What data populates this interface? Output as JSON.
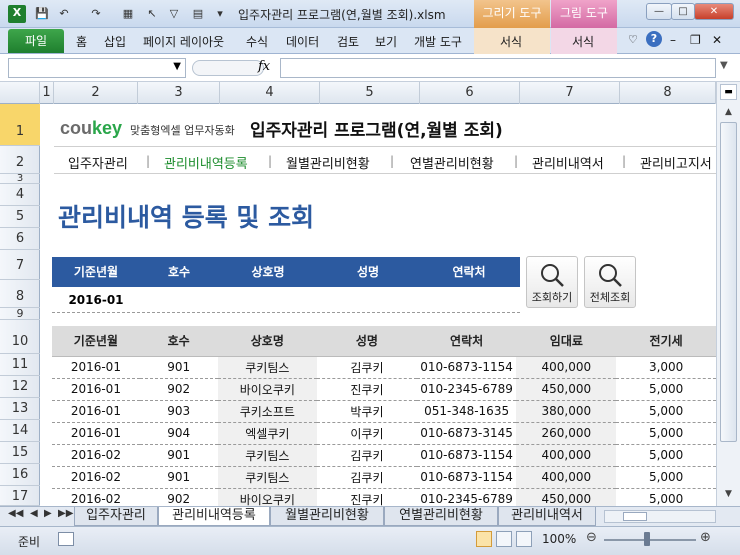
{
  "window": {
    "title": "입주자관리 프로그램(연,월별 조회).xlsm",
    "context_tabs": [
      "그리기 도구",
      "그림 도구"
    ]
  },
  "ribbon": {
    "file": "파일",
    "tabs": [
      "홈",
      "삽입",
      "페이지 레이아웃",
      "수식",
      "데이터",
      "검토",
      "보기",
      "개발 도구"
    ],
    "context_sub": [
      "서식",
      "서식"
    ]
  },
  "formula_bar": {
    "fx": "fx"
  },
  "columns": [
    "1",
    "2",
    "3",
    "4",
    "5",
    "6",
    "7",
    "8"
  ],
  "rows": [
    "1",
    "2",
    "3",
    "4",
    "5",
    "6",
    "7",
    "8",
    "9",
    "10",
    "11",
    "12",
    "13",
    "14",
    "15",
    "16",
    "17"
  ],
  "brand": {
    "logo_cou": "cou",
    "logo_key": "key",
    "tagline": "맞춤형엑셀 업무자동화",
    "title": "입주자관리 프로그램(연,월별 조회)"
  },
  "menu": [
    "입주자관리",
    "관리비내역등록",
    "월별관리비현황",
    "연별관리비현황",
    "관리비내역서",
    "관리비고지서"
  ],
  "page_heading": "관리비내역 등록 및 조회",
  "search_panel": {
    "headers": [
      "기준년월",
      "호수",
      "상호명",
      "성명",
      "연락처"
    ],
    "values": [
      "2016-01",
      "",
      "",
      "",
      ""
    ]
  },
  "buttons": {
    "search": "조회하기",
    "search_all": "전체조회"
  },
  "table": {
    "headers": [
      "기준년월",
      "호수",
      "상호명",
      "성명",
      "연락처",
      "임대료",
      "전기세"
    ],
    "rows": [
      [
        "2016-01",
        "901",
        "쿠키팀스",
        "김쿠키",
        "010-6873-1154",
        "400,000",
        "3,000"
      ],
      [
        "2016-01",
        "902",
        "바이오쿠키",
        "진쿠키",
        "010-2345-6789",
        "450,000",
        "5,000"
      ],
      [
        "2016-01",
        "903",
        "쿠키소프트",
        "박쿠키",
        "051-348-1635",
        "380,000",
        "5,000"
      ],
      [
        "2016-01",
        "904",
        "엑셀쿠키",
        "이쿠키",
        "010-6873-3145",
        "260,000",
        "5,000"
      ],
      [
        "2016-02",
        "901",
        "쿠키팀스",
        "김쿠키",
        "010-6873-1154",
        "400,000",
        "5,000"
      ],
      [
        "2016-02",
        "901",
        "쿠키팀스",
        "김쿠키",
        "010-6873-1154",
        "400,000",
        "5,000"
      ],
      [
        "2016-02",
        "902",
        "바이오쿠키",
        "진쿠키",
        "010-2345-6789",
        "450,000",
        "5,000"
      ]
    ]
  },
  "sheet_tabs": [
    "입주자관리",
    "관리비내역등록",
    "월별관리비현황",
    "연별관리비현황",
    "관리비내역서"
  ],
  "status": {
    "ready": "준비",
    "zoom": "100%"
  },
  "colors": {
    "brand_blue": "#2c5aa0",
    "brand_green": "#1c8c2c",
    "file_tab": "#1f7f2e",
    "context_draw": "#e8a85a",
    "context_pic": "#d86ca6"
  }
}
